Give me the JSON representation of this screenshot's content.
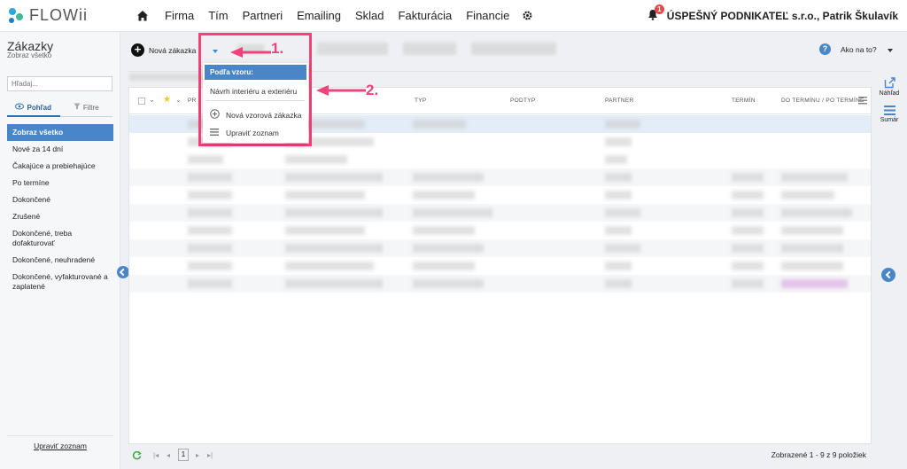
{
  "app": {
    "name": "FLOWii"
  },
  "nav": {
    "links": [
      "Firma",
      "Tím",
      "Partneri",
      "Emailing",
      "Sklad",
      "Fakturácia",
      "Financie"
    ],
    "notification_count": "1",
    "company": "ÚSPEŠNÝ PODNIKATEĽ s.r.o., Patrik Škulavík"
  },
  "sidebar": {
    "title": "Zákazky",
    "subtitle": "Zobraz všetko",
    "search_placeholder": "Hľadaj...",
    "tabs": {
      "view": "Pohľad",
      "filters": "Filtre"
    },
    "items": [
      "Zobraz všetko",
      "Nové za 14 dní",
      "Čakajúce a prebiehajúce",
      "Po termíne",
      "Dokončené",
      "Zrušené",
      "Dokončené, treba dofakturovať",
      "Dokončené, neuhradené",
      "Dokončené, vyfakturované a zaplatené"
    ],
    "footer_link": "Upraviť zoznam"
  },
  "toolbar": {
    "new_order": "Nová zákazka",
    "help": "Ako na to?"
  },
  "rail": {
    "preview": "Náhľad",
    "summary": "Sumár"
  },
  "grid": {
    "columns": {
      "c1": "PR",
      "type": "TYP",
      "subtype": "PODTYP",
      "partner": "PARTNER",
      "deadline": "TERMÍN",
      "to_deadline": "DO TERMÍNU / PO TERMÍNE"
    }
  },
  "dropdown": {
    "header": "Podľa vzoru:",
    "template_item": "Návrh interiéru a exteriéru",
    "new_template": "Nová vzorová zákazka",
    "edit_list": "Upraviť zoznam"
  },
  "annotations": {
    "step1": "1.",
    "step2": "2."
  },
  "pager": {
    "page": "1",
    "info": "Zobrazené 1 - 9 z 9 položiek"
  },
  "colors": {
    "accent": "#4a86c7",
    "annotation": "#f0437a"
  }
}
